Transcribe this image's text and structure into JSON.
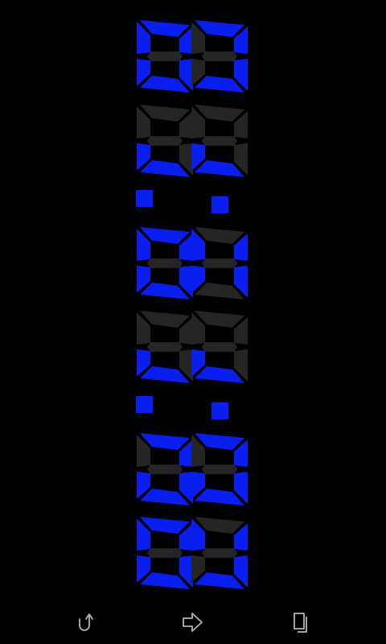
{
  "clock": {
    "digits": [
      [
        [
          1,
          1,
          1,
          0,
          1,
          1,
          1
        ],
        [
          0,
          1,
          1,
          0,
          0,
          1,
          1
        ]
      ],
      [
        [
          0,
          0,
          0,
          0,
          1,
          1,
          0
        ],
        [
          0,
          0,
          0,
          0,
          1,
          1,
          0
        ]
      ],
      [
        [
          1,
          1,
          1,
          0,
          1,
          1,
          1
        ],
        [
          1,
          0,
          1,
          0,
          1,
          0,
          1
        ]
      ],
      [
        [
          0,
          0,
          0,
          0,
          1,
          1,
          0
        ],
        [
          0,
          0,
          0,
          0,
          1,
          1,
          0
        ]
      ],
      [
        [
          0,
          1,
          1,
          0,
          1,
          1,
          1
        ],
        [
          0,
          1,
          1,
          0,
          1,
          1,
          1
        ]
      ],
      [
        [
          1,
          1,
          1,
          0,
          1,
          1,
          1
        ],
        [
          1,
          0,
          1,
          0,
          0,
          1,
          1
        ]
      ]
    ],
    "on_color": "#0a1ef0",
    "off_color": "#252525"
  },
  "navbar": {
    "buttons": [
      {
        "name": "rotate-button",
        "icon": "rotate-icon"
      },
      {
        "name": "send-button",
        "icon": "arrow-right-icon"
      },
      {
        "name": "copy-button",
        "icon": "copy-icon"
      }
    ],
    "icon_color": "#b4b4b4"
  }
}
